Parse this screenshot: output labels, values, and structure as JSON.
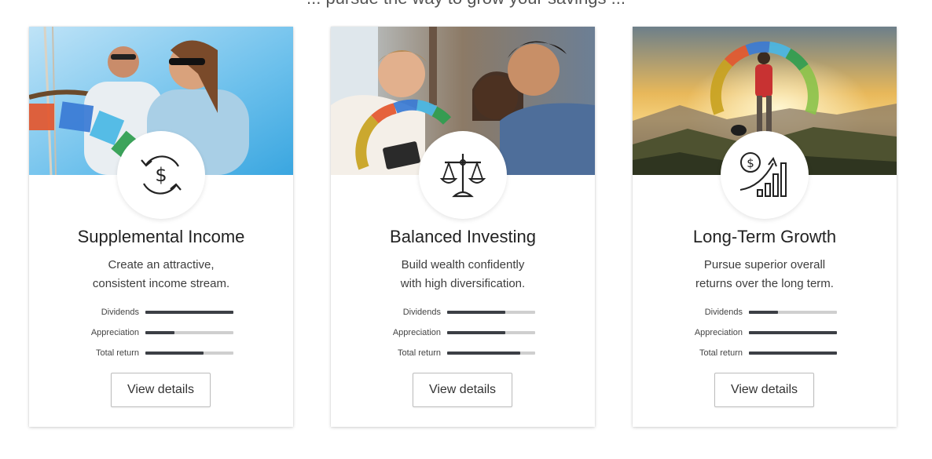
{
  "header": {
    "partial_text": "... pursue the way to grow your savings ..."
  },
  "cards": [
    {
      "title": "Supplemental Income",
      "description_line1": "Create an attractive,",
      "description_line2": "consistent income stream.",
      "photo": "sailboat-couple-photo",
      "icon": "dollar-cycle-icon",
      "metrics": [
        {
          "label": "Dividends",
          "value": 1.0
        },
        {
          "label": "Appreciation",
          "value": 0.33
        },
        {
          "label": "Total return",
          "value": 0.66
        }
      ],
      "button_label": "View details"
    },
    {
      "title": "Balanced Investing",
      "description_line1": "Build wealth confidently",
      "description_line2": "with high diversification.",
      "photo": "friends-phone-photo",
      "icon": "balance-scale-icon",
      "metrics": [
        {
          "label": "Dividends",
          "value": 0.66
        },
        {
          "label": "Appreciation",
          "value": 0.66
        },
        {
          "label": "Total return",
          "value": 0.83
        }
      ],
      "button_label": "View details"
    },
    {
      "title": "Long-Term Growth",
      "description_line1": "Pursue superior overall",
      "description_line2": "returns over the long term.",
      "photo": "hiker-sunset-photo",
      "icon": "growth-chart-icon",
      "metrics": [
        {
          "label": "Dividends",
          "value": 0.33
        },
        {
          "label": "Appreciation",
          "value": 1.0
        },
        {
          "label": "Total return",
          "value": 1.0
        }
      ],
      "button_label": "View details"
    }
  ],
  "colors": {
    "bar_fill": "#3c3f45",
    "bar_track": "#cfcfcf",
    "gauge": [
      "#e4572e",
      "#3a7bd5",
      "#49b8e6",
      "#2e9e4f",
      "#8bc34a"
    ]
  }
}
